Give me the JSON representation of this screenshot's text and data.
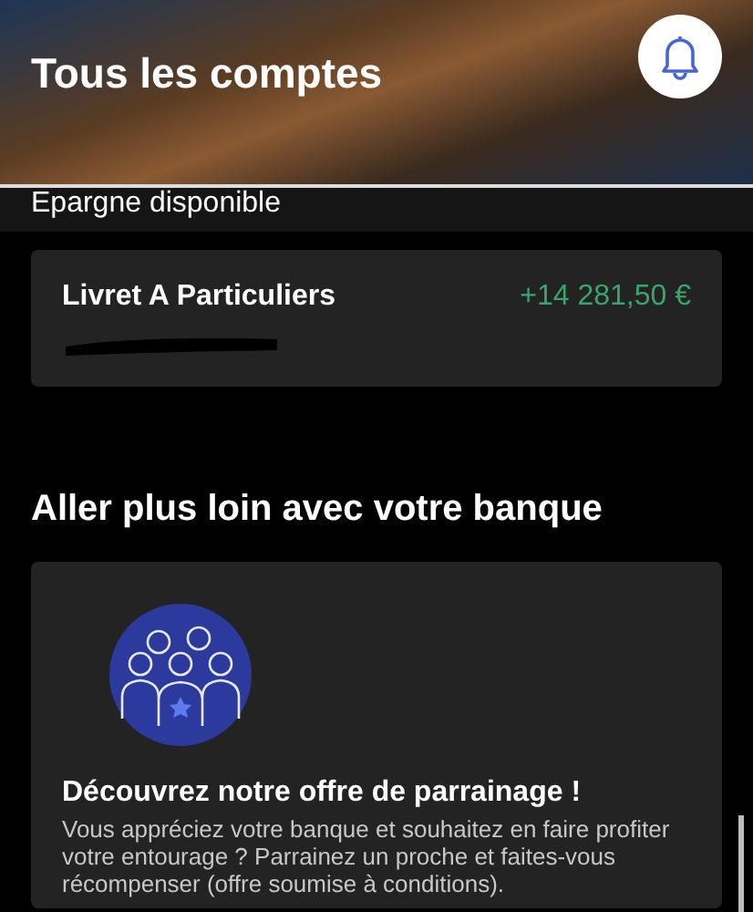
{
  "header": {
    "title": "Tous les comptes"
  },
  "section": {
    "label": "Epargne disponible"
  },
  "accounts": [
    {
      "name": "Livret A Particuliers",
      "amount": "+14 281,50 €",
      "redacted": true
    }
  ],
  "promo_heading": "Aller plus loin avec votre banque",
  "promo_card": {
    "title": "Découvrez notre offre de parrainage !",
    "text": "Vous appréciez votre banque et souhaitez en faire profiter votre entourage ? Parrainez un proche et faites-vous récompenser (offre soumise à conditions)."
  }
}
